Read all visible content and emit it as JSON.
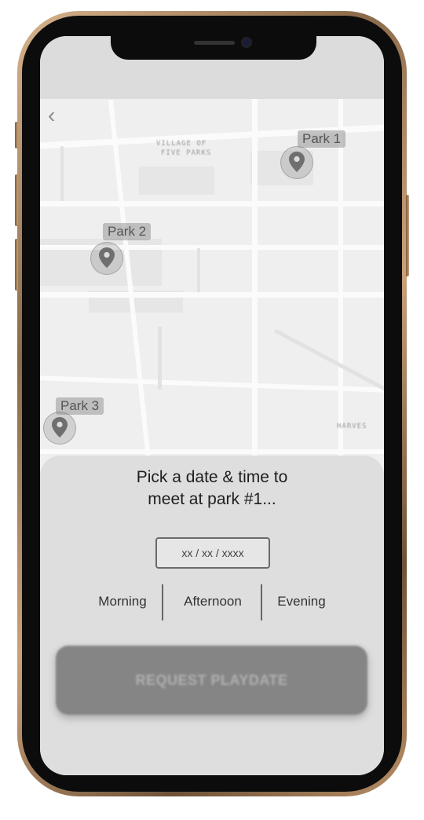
{
  "map": {
    "labels": [
      "VILLAGE OF",
      "FIVE PARKS",
      "HARVES"
    ],
    "back_glyph": "‹"
  },
  "parks": [
    {
      "label": "Park 1"
    },
    {
      "label": "Park 2"
    },
    {
      "label": "Park 3"
    }
  ],
  "sheet": {
    "heading_line1": "Pick a date & time to",
    "heading_line2": "meet at park #1...",
    "date_placeholder": "xx / xx / xxxx",
    "time_options": [
      "Morning",
      "Afternoon",
      "Evening"
    ],
    "request_button": "REQUEST PLAYDATE"
  },
  "colors": {
    "frame": "#b88f66",
    "sheet_bg": "#dedede",
    "button_bg": "#858585"
  }
}
